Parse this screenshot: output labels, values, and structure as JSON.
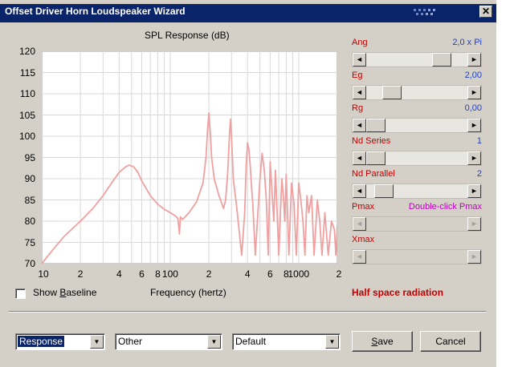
{
  "window": {
    "title": "Offset Driver Horn Loudspeaker Wizard",
    "close_glyph": "✕"
  },
  "chart_data": {
    "type": "line",
    "title": "SPL Response (dB)",
    "xlabel": "Frequency (hertz)",
    "ylabel": "",
    "x_scale": "log",
    "xlim": [
      10,
      2000
    ],
    "ylim": [
      70,
      120
    ],
    "grid": true,
    "yticks": [
      "120",
      "115",
      "110",
      "105",
      "100",
      "95",
      "90",
      "85",
      "80",
      "75",
      "70"
    ],
    "xticks": [
      {
        "label": "10",
        "value": 10
      },
      {
        "label": "2",
        "value": 20
      },
      {
        "label": "4",
        "value": 40
      },
      {
        "label": "6",
        "value": 60
      },
      {
        "label": "8",
        "value": 80
      },
      {
        "label": "100",
        "value": 100
      },
      {
        "label": "2",
        "value": 200
      },
      {
        "label": "4",
        "value": 400
      },
      {
        "label": "6",
        "value": 600
      },
      {
        "label": "8",
        "value": 800
      },
      {
        "label": "1000",
        "value": 1000
      },
      {
        "label": "2",
        "value": 2000
      }
    ],
    "series": [
      {
        "color": "#f0a0a0",
        "x": [
          10,
          12,
          15,
          20,
          25,
          30,
          35,
          40,
          45,
          48,
          52,
          56,
          60,
          70,
          80,
          90,
          100,
          110,
          115,
          118,
          120,
          125,
          140,
          160,
          180,
          190,
          195,
          200,
          205,
          210,
          220,
          240,
          260,
          270,
          280,
          290,
          295,
          300,
          305,
          310,
          330,
          360,
          380,
          390,
          400,
          410,
          420,
          430,
          440,
          460,
          500,
          520,
          540,
          560,
          580,
          600,
          620,
          640,
          660,
          700,
          740,
          760,
          780,
          800,
          840,
          880,
          920,
          960,
          1000,
          1040,
          1080,
          1120,
          1160,
          1200,
          1260,
          1320,
          1400,
          1460,
          1520,
          1600,
          1700,
          1800,
          1900,
          1950,
          2000
        ],
        "y": [
          70,
          73,
          76.5,
          80,
          83,
          86,
          89,
          91.5,
          92.8,
          93.2,
          92.8,
          91.5,
          89.5,
          86,
          84,
          82.8,
          82,
          81.2,
          80.6,
          77,
          81,
          80.4,
          82,
          84.5,
          89,
          95,
          101,
          105.5,
          101,
          95,
          90,
          86,
          83,
          85,
          91,
          101,
          104,
          100,
          95,
          90,
          83,
          72,
          82,
          93,
          98.5,
          97,
          93,
          88,
          84,
          72,
          90,
          96,
          92,
          85,
          72,
          94,
          87,
          80,
          92,
          72,
          90,
          86,
          80,
          91,
          72,
          89,
          84,
          72,
          89,
          85,
          80,
          72,
          86,
          82,
          86,
          72,
          85,
          80,
          72,
          82,
          72,
          80,
          78,
          72,
          79
        ]
      }
    ]
  },
  "params": [
    {
      "label": "Ang",
      "value": "2,0 x Pi"
    },
    {
      "label": "Eg",
      "value": "2,00"
    },
    {
      "label": "Rg",
      "value": "0,00"
    },
    {
      "label": "Nd  Series",
      "value": "1"
    },
    {
      "label": "Nd  Parallel",
      "value": "2"
    },
    {
      "label": "Pmax",
      "value": "Double-click Pmax"
    },
    {
      "label": "Xmax",
      "value": ""
    }
  ],
  "sliders": [
    {
      "name": "ang",
      "level": 0.8,
      "enabled": true
    },
    {
      "name": "eg",
      "level": 0.2,
      "enabled": true
    },
    {
      "name": "rg",
      "level": 0.0,
      "enabled": true
    },
    {
      "name": "nd-series",
      "level": 0.0,
      "enabled": true
    },
    {
      "name": "nd-parallel",
      "level": 0.1,
      "enabled": true
    },
    {
      "name": "pmax",
      "level": 0.0,
      "enabled": false
    },
    {
      "name": "xmax",
      "level": 0.0,
      "enabled": false
    }
  ],
  "show_baseline": {
    "checked": false,
    "label_pre": "Show ",
    "label_u": "B",
    "label_post": "aseline"
  },
  "half_space": "Half space radiation",
  "combos": {
    "response": "Response",
    "other": "Other",
    "default": "Default"
  },
  "buttons": {
    "save_u": "S",
    "save_rest": "ave",
    "cancel": "Cancel"
  },
  "colors": {
    "title_bar": "#0a246a",
    "label_red": "#c00000",
    "value_blue": "#2040c0",
    "value_magenta": "#c000c0",
    "curve": "#f0a0a0"
  }
}
